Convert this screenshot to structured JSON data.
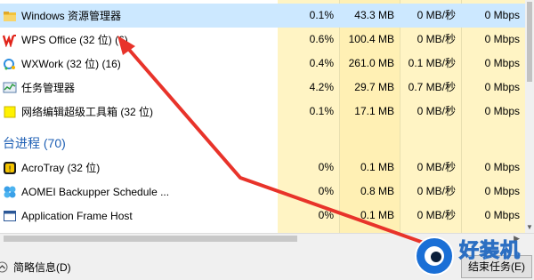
{
  "processes": [
    {
      "name": "Windows 资源管理器",
      "cpu": "0.1%",
      "memory": "43.3 MB",
      "disk": "0 MB/秒",
      "network": "0 Mbps",
      "icon": "folder-icon",
      "selected": true
    },
    {
      "name": "WPS Office (32 位) (6)",
      "cpu": "0.6%",
      "memory": "100.4 MB",
      "disk": "0 MB/秒",
      "network": "0 Mbps",
      "icon": "wps-icon"
    },
    {
      "name": "WXWork (32 位) (16)",
      "cpu": "0.4%",
      "memory": "261.0 MB",
      "disk": "0.1 MB/秒",
      "network": "0 Mbps",
      "icon": "wxwork-icon"
    },
    {
      "name": "任务管理器",
      "cpu": "4.2%",
      "memory": "29.7 MB",
      "disk": "0.7 MB/秒",
      "network": "0 Mbps",
      "icon": "task-manager-icon"
    },
    {
      "name": "网络编辑超级工具箱 (32 位)",
      "cpu": "0.1%",
      "memory": "17.1 MB",
      "disk": "0 MB/秒",
      "network": "0 Mbps",
      "icon": "toolbox-icon"
    }
  ],
  "background_group": {
    "label": "台进程 (70)"
  },
  "background_processes": [
    {
      "name": "AcroTray (32 位)",
      "cpu": "0%",
      "memory": "0.1 MB",
      "disk": "0 MB/秒",
      "network": "0 Mbps",
      "icon": "acrotray-icon"
    },
    {
      "name": "AOMEI Backupper Schedule ...",
      "cpu": "0%",
      "memory": "0.8 MB",
      "disk": "0 MB/秒",
      "network": "0 Mbps",
      "icon": "aomei-icon"
    },
    {
      "name": "Application Frame Host",
      "cpu": "0%",
      "memory": "0.1 MB",
      "disk": "0 MB/秒",
      "network": "0 Mbps",
      "icon": "app-frame-icon"
    }
  ],
  "footer": {
    "brief_label": "简略信息(D)",
    "end_task_label": "结束任务(E)"
  },
  "watermark": {
    "text": "好装机"
  },
  "colors": {
    "selected_row": "#cce8ff",
    "cpu_col": "#fff4c4",
    "group_label": "#1e5fb4",
    "annotation_arrow": "#e8332a"
  }
}
